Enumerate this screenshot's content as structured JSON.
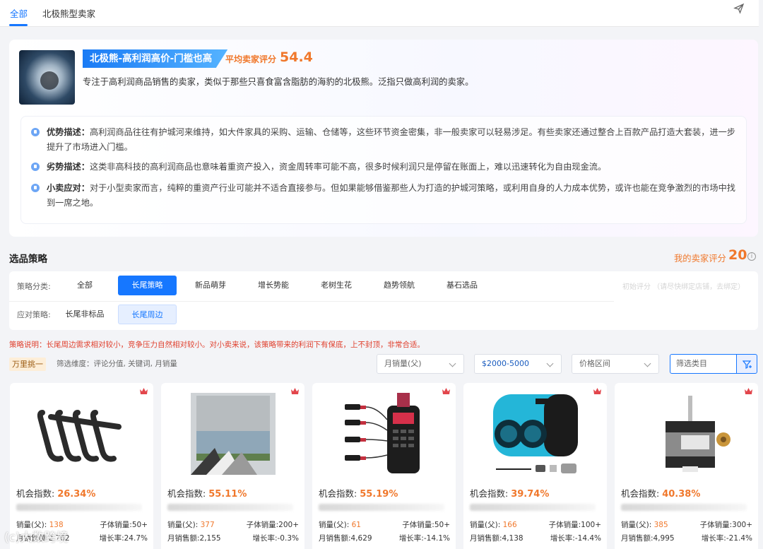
{
  "tabs": [
    {
      "label": "全部",
      "active": true
    },
    {
      "label": "北极熊型卖家",
      "active": false
    }
  ],
  "profile": {
    "title": "北极熊-高利润高价-门槛也高",
    "score_label": "平均卖家评分",
    "score_value": "54.4",
    "description": "专注于高利润商品销售的卖家，类似于那些只喜食富含脂肪的海豹的北极熊。泛指只做高利润的卖家。",
    "advice": [
      {
        "label": "优势描述：",
        "text": "高利润商品往往有护城河来维持，如大件家具的采购、运输、仓储等，这些环节资金密集，非一般卖家可以轻易涉足。有些卖家还通过整合上百款产品打造大套装，进一步提升了市场进入门槛。",
        "icon": "thumbs-up-icon"
      },
      {
        "label": "劣势描述：",
        "text": "这类非高科技的高利润商品也意味着重资产投入，资金周转率可能不高，很多时候利润只是停留在账面上，难以迅速转化为自由现金流。",
        "icon": "thumbs-down-icon"
      },
      {
        "label": "小卖应对：",
        "text": "对于小型卖家而言，纯粹的重资产行业可能并不适合直接参与。但如果能够借鉴那些人为打造的护城河策略，或利用自身的人力成本优势，或许也能在竞争激烈的市场中找到一席之地。",
        "icon": "location-pin-icon"
      }
    ]
  },
  "strategy": {
    "section_title": "选品策略",
    "my_score_label": "我的卖家评分",
    "my_score_value": "20",
    "category_label": "策略分类:",
    "categories": [
      "全部",
      "长尾策略",
      "新品萌芽",
      "增长势能",
      "老树生花",
      "趋势领航",
      "基石选品"
    ],
    "active_category": "长尾策略",
    "init_score": "初始评分 （请尽快绑定店铺，去绑定）",
    "response_label": "应对策略:",
    "responses": [
      "长尾非标品",
      "长尾周边"
    ],
    "active_response": "长尾周边",
    "note": "策略说明：长尾周边需求相对较小，竞争压力自然相对较小。对小卖来说，该策略带来的利润下有保底，上不封顶，非常合适。",
    "pick_tag": "万里挑一",
    "dims": "筛选维度：评论分值, 关键词, 月销量",
    "filters": {
      "sales": "月销量(父)",
      "price_range": "$2000-5000",
      "price_interval": "价格区间",
      "category_placeholder": "筛选类目"
    }
  },
  "products": [
    {
      "opportunity_label": "机会指数:",
      "opportunity": "26.34%",
      "sales_label": "销量(父):",
      "sales": "138",
      "child_sales": "子体销量:50+",
      "revenue": "月销售额:2,762",
      "growth": "增长率:24.7%"
    },
    {
      "opportunity_label": "机会指数:",
      "opportunity": "55.11%",
      "sales_label": "销量(父):",
      "sales": "377",
      "child_sales": "子体销量:200+",
      "revenue": "月销售额:2,155",
      "growth": "增长率:-0.3%"
    },
    {
      "opportunity_label": "机会指数:",
      "opportunity": "55.19%",
      "sales_label": "销量(父):",
      "sales": "61",
      "child_sales": "子体销量:50+",
      "revenue": "月销售额:4,629",
      "growth": "增长率:-14.1%"
    },
    {
      "opportunity_label": "机会指数:",
      "opportunity": "39.74%",
      "sales_label": "销量(父):",
      "sales": "166",
      "child_sales": "子体销量:100+",
      "revenue": "月销售额:4,138",
      "growth": "增长率:-14.4%"
    },
    {
      "opportunity_label": "机会指数:",
      "opportunity": "40.38%",
      "sales_label": "销量(父):",
      "sales": "385",
      "child_sales": "子体销量:300+",
      "revenue": "月销售额:4,995",
      "growth": "增长率:-21.4%"
    }
  ],
  "watermark": "(c)大数跨境",
  "colors": {
    "accent": "#1677ff",
    "score": "#f0782c",
    "note": "#e0412f"
  }
}
